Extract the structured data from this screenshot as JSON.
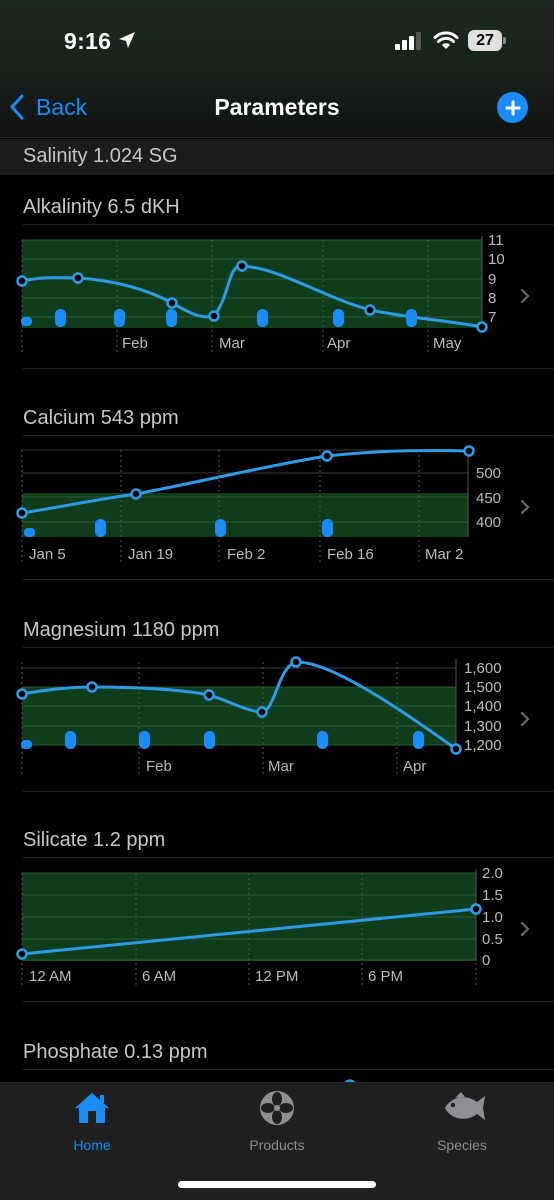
{
  "status": {
    "time": "9:16",
    "battery": "27"
  },
  "nav": {
    "back_label": "Back",
    "title": "Parameters"
  },
  "salinity": "Salinity 1.024 SG",
  "alkalinity": {
    "title": "Alkalinity 6.5 dKH",
    "y_ticks": [
      "11",
      "10",
      "9",
      "8",
      "7"
    ],
    "x_ticks": [
      "Feb",
      "Mar",
      "Apr",
      "May"
    ]
  },
  "calcium": {
    "title": "Calcium 543 ppm",
    "y_ticks": [
      "500",
      "450",
      "400"
    ],
    "x_ticks": [
      "Jan 5",
      "Jan 19",
      "Feb 2",
      "Feb 16",
      "Mar 2"
    ]
  },
  "magnesium": {
    "title": "Magnesium 1180 ppm",
    "y_ticks": [
      "1,600",
      "1,500",
      "1,400",
      "1,300",
      "1,200"
    ],
    "x_ticks": [
      "Feb",
      "Mar",
      "Apr"
    ]
  },
  "silicate": {
    "title": "Silicate 1.2 ppm",
    "y_ticks": [
      "2.0",
      "1.5",
      "1.0",
      "0.5",
      "0"
    ],
    "x_ticks": [
      "12 AM",
      "6 AM",
      "12 PM",
      "6 PM"
    ]
  },
  "phosphate": {
    "title": "Phosphate 0.13 ppm"
  },
  "tabs": [
    {
      "label": "Home",
      "icon": "house-icon",
      "color": "#1b8cf7"
    },
    {
      "label": "Products",
      "icon": "fan-icon",
      "color": "#8e8e93"
    },
    {
      "label": "Species",
      "icon": "fish-icon",
      "color": "#8e8e93"
    }
  ],
  "colors": {
    "accent": "#1b8cf7",
    "range_band": "#0f3d1c",
    "line": "#2e9be6"
  }
}
